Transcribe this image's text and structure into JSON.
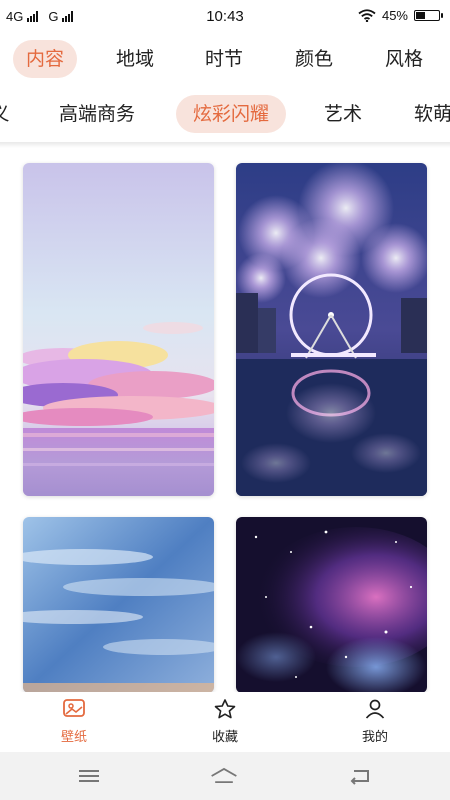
{
  "status_bar": {
    "network_1": "4G",
    "network_2": "G",
    "time": "10:43",
    "battery": "45%",
    "battery_level": 0.45
  },
  "categories_primary": [
    {
      "label": "内容",
      "active": true
    },
    {
      "label": "地域",
      "active": false
    },
    {
      "label": "时节",
      "active": false
    },
    {
      "label": "颜色",
      "active": false
    },
    {
      "label": "风格",
      "active": false
    }
  ],
  "categories_secondary": [
    {
      "label": "义",
      "active": false
    },
    {
      "label": "高端商务",
      "active": false
    },
    {
      "label": "炫彩闪耀",
      "active": true
    },
    {
      "label": "艺术",
      "active": false
    },
    {
      "label": "软萌",
      "active": false
    }
  ],
  "wallpapers": [
    {
      "name": "pastel-cloud-sea"
    },
    {
      "name": "fireworks-ferris-wheel"
    },
    {
      "name": "blue-sky-clouds"
    },
    {
      "name": "galaxy-nebula"
    }
  ],
  "bottom_nav": [
    {
      "label": "壁纸",
      "icon": "wallpaper-icon",
      "active": true
    },
    {
      "label": "收藏",
      "icon": "star-icon",
      "active": false
    },
    {
      "label": "我的",
      "icon": "person-icon",
      "active": false
    }
  ],
  "system_nav": [
    "menu-icon",
    "home-icon",
    "back-icon"
  ],
  "colors": {
    "accent": "#e46a3f",
    "accent_bg": "#f8e3dc"
  }
}
